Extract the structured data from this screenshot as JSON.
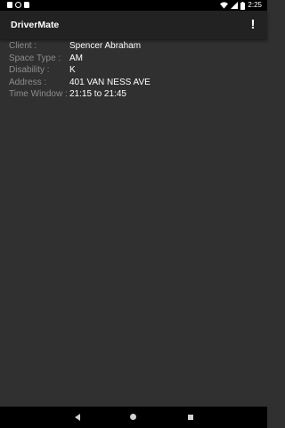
{
  "status_bar": {
    "time": "2:25",
    "icons": [
      "notification-icon",
      "sync-icon",
      "sd-card-icon",
      "wifi-icon",
      "signal-icon",
      "battery-icon"
    ]
  },
  "app_bar": {
    "title": "DriverMate",
    "overflow_label": "!"
  },
  "details": [
    {
      "label": "Client :",
      "value": "Spencer Abraham"
    },
    {
      "label": "Space Type :",
      "value": "AM"
    },
    {
      "label": "Disability :",
      "value": "K"
    },
    {
      "label": "Address :",
      "value": "401 VAN NESS AVE"
    },
    {
      "label": "Time Window :",
      "value": "21:15 to 21:45"
    }
  ],
  "colors": {
    "background": "#303030",
    "app_bar": "#222222",
    "label": "#8c8c8c",
    "value": "#ffffff"
  }
}
